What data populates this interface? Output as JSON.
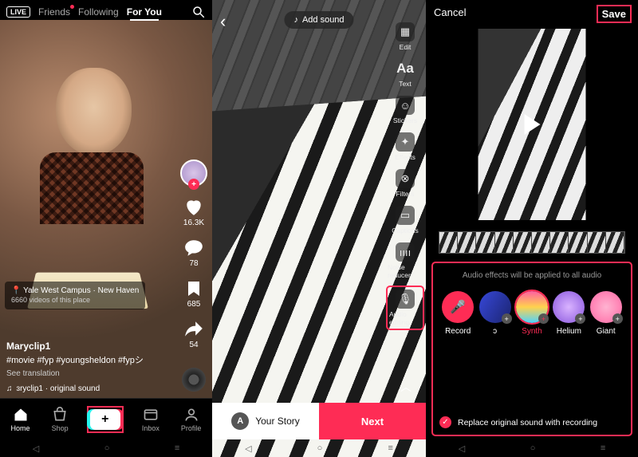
{
  "feed": {
    "live_label": "LIVE",
    "tabs": {
      "friends": "Friends",
      "following": "Following",
      "for_you": "For You"
    },
    "rail": {
      "likes": "16.3K",
      "comments": "78",
      "saves": "685",
      "shares": "54"
    },
    "location": {
      "title": "Yale West Campus · New Haven",
      "sub": "6660 videos of this place"
    },
    "username": "Maryclip1",
    "caption": "#movie #fyp #youngsheldon #fypシ",
    "see_translation": "See translation",
    "sound": "ɜryclip1 · original sound",
    "nav": {
      "home": "Home",
      "shop": "Shop",
      "inbox": "Inbox",
      "profile": "Profile"
    }
  },
  "editor": {
    "add_sound": "Add sound",
    "tools": {
      "edit": "Edit",
      "text": "Text",
      "text_glyph": "Aa",
      "stickers": "Stickers",
      "effects": "Effects",
      "filters": "Filters",
      "captions": "Captions",
      "noise": "Noise reducer",
      "audio": "Audio editing"
    },
    "your_story": "Your Story",
    "story_initial": "A",
    "next": "Next"
  },
  "audio": {
    "cancel": "Cancel",
    "save": "Save",
    "note": "Audio effects will be applied to all audio",
    "fx": {
      "record": "Record",
      "b": "ɔ",
      "synth": "Synth",
      "helium": "Helium",
      "giant": "Giant"
    },
    "replace": "Replace original sound with recording"
  }
}
